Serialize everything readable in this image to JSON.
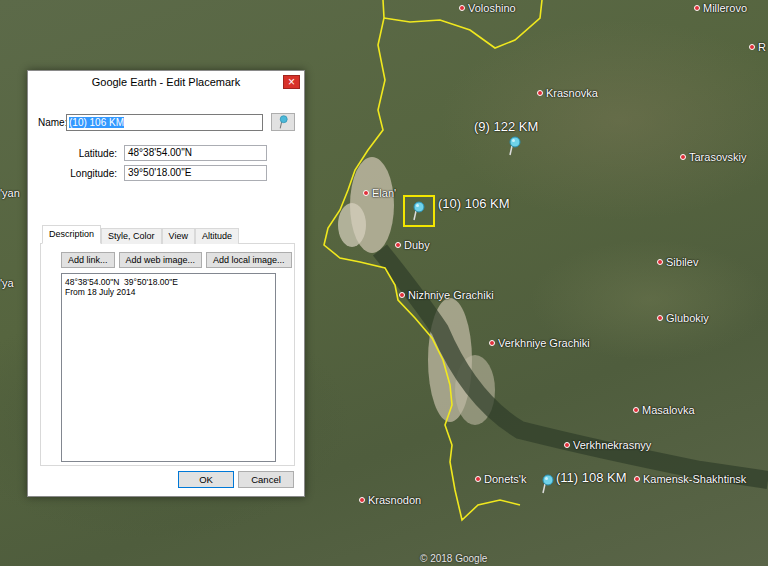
{
  "map": {
    "places": [
      {
        "name": "Voloshino"
      },
      {
        "name": "Millerovo"
      },
      {
        "name": "R"
      },
      {
        "name": "Krasnovka"
      },
      {
        "name": "Tarasovskiy"
      },
      {
        "name": "'yan"
      },
      {
        "name": "Elan'"
      },
      {
        "name": "Duby"
      },
      {
        "name": "Sibilev"
      },
      {
        "name": "'ya"
      },
      {
        "name": "Nizhniye Grachiki"
      },
      {
        "name": "Glubokiy"
      },
      {
        "name": "Verkhniye Grachiki"
      },
      {
        "name": "Masalovka"
      },
      {
        "name": "Verkhnekrasnyy"
      },
      {
        "name": "Donets'k"
      },
      {
        "name": "Kamensk-Shakhtinsk"
      },
      {
        "name": "Krasnodon"
      }
    ],
    "placemarks": [
      {
        "label": "(9) 122 KM",
        "selected": false
      },
      {
        "label": "(10) 106 KM",
        "selected": true
      },
      {
        "label": "(11) 108 KM",
        "selected": false
      }
    ],
    "attribution": "© 2018 Google"
  },
  "dialog": {
    "title": "Google Earth - Edit Placemark",
    "close": "×",
    "name": {
      "label": "Name:",
      "value": "(10) 106 KM",
      "selected": true
    },
    "fields": [
      {
        "label": "Latitude:",
        "value": "48°38'54.00\"N"
      },
      {
        "label": "Longitude:",
        "value": "39°50'18.00\"E"
      }
    ],
    "tabs": [
      {
        "label": "Description",
        "selected": true
      },
      {
        "label": "Style, Color",
        "selected": false
      },
      {
        "label": "View",
        "selected": false
      },
      {
        "label": "Altitude",
        "selected": false
      }
    ],
    "insert_buttons": [
      "Add link...",
      "Add web image...",
      "Add local image..."
    ],
    "description": [
      "48°38'54.00\"N  39°50'18.00\"E",
      "From 18 July 2014"
    ],
    "buttons": [
      {
        "label": "OK",
        "default": true
      },
      {
        "label": "Cancel",
        "default": false
      }
    ]
  }
}
